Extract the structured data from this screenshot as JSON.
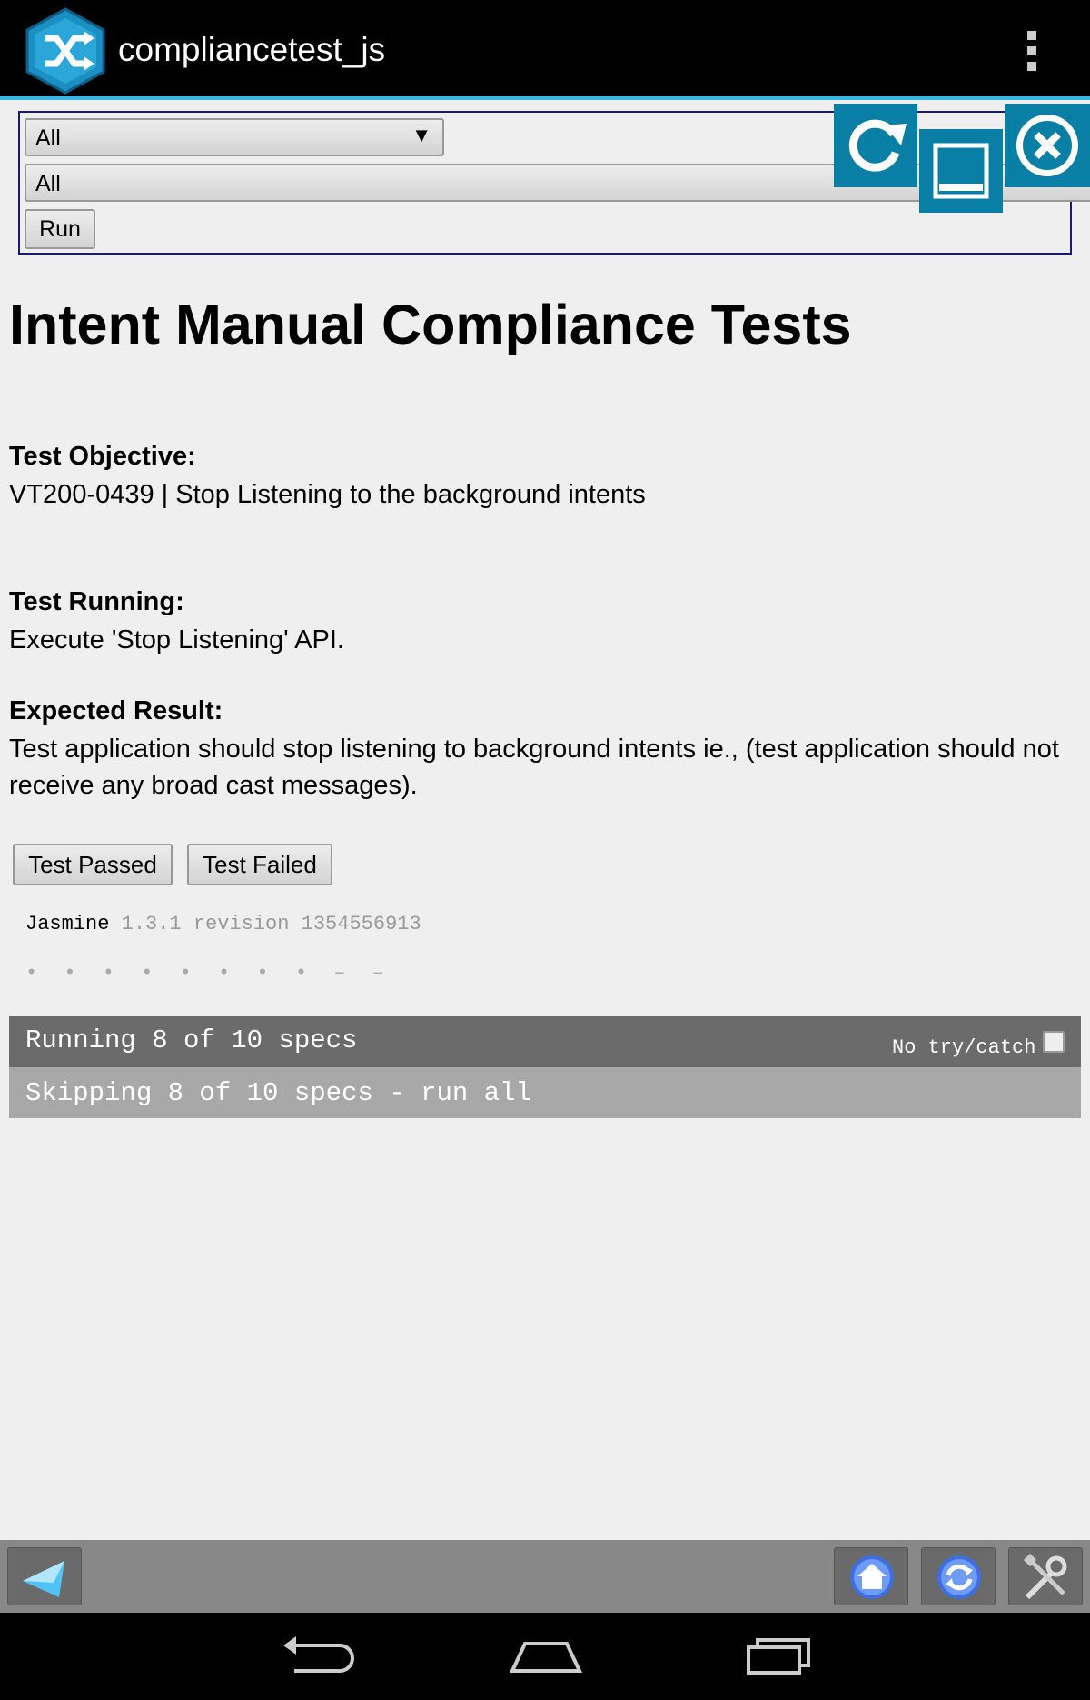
{
  "app": {
    "title": "compliancetest_js",
    "accent": "#33b5e5"
  },
  "filters": {
    "select1_value": "All",
    "select2_value": "All",
    "run_label": "Run"
  },
  "content": {
    "heading": "Intent Manual Compliance Tests",
    "objective_label": "Test Objective:",
    "objective_text": "VT200-0439 | Stop Listening to the background intents",
    "running_label": "Test Running:",
    "running_text": "Execute 'Stop Listening' API.",
    "expected_label": "Expected Result:",
    "expected_text": "Test application should stop listening to background intents ie., (test application should not receive any broad cast messages).",
    "pass_label": "Test Passed",
    "fail_label": "Test Failed"
  },
  "jasmine": {
    "name": "Jasmine",
    "version": "1.3.1 revision 1354556913",
    "dots": "• • • • • • • • – –",
    "running": "Running 8 of 10 specs",
    "no_try_catch": "No try/catch",
    "skipping": "Skipping 8 of 10 specs - run all"
  },
  "icons": {
    "logo": "shuffle-logo-icon",
    "overflow": "overflow-menu-icon",
    "reload": "reload-icon",
    "minimize": "minimize-icon",
    "close": "close-icon",
    "back": "back-arrow-icon",
    "home": "home-icon",
    "refresh": "refresh-icon",
    "settings": "wrench-settings-icon"
  }
}
